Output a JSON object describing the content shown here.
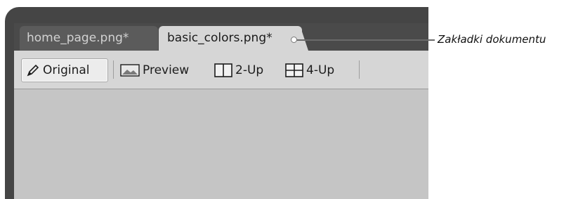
{
  "tabs": [
    {
      "label": "home_page.png*",
      "active": false
    },
    {
      "label": "basic_colors.png*",
      "active": true
    }
  ],
  "toolbar": {
    "original_label": "Original",
    "preview_label": "Preview",
    "two_up_label": "2-Up",
    "four_up_label": "4-Up"
  },
  "annotation": {
    "label": "Zakładki dokumentu"
  },
  "colors": {
    "frame": "#454545",
    "tab_strip": "#4a4a4a",
    "active_tab": "#d6d6d6",
    "inactive_tab": "#5b5b5b",
    "canvas": "#c5c5c5"
  }
}
